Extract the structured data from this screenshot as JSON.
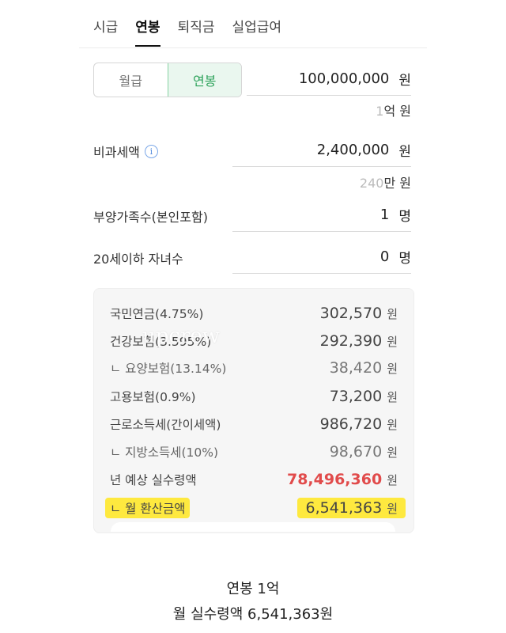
{
  "tabs": [
    {
      "label": "시급",
      "active": false
    },
    {
      "label": "연봉",
      "active": true
    },
    {
      "label": "퇴직금",
      "active": false
    },
    {
      "label": "실업급여",
      "active": false
    }
  ],
  "mode": {
    "monthly_label": "월급",
    "annual_label": "연봉",
    "selected": "연봉"
  },
  "salary": {
    "value": "100,000,000",
    "unit": "원",
    "hint_num": "1",
    "hint_text": "억 원"
  },
  "nontax": {
    "label": "비과세액",
    "info_icon": "i",
    "value": "2,400,000",
    "unit": "원",
    "hint_num": "240",
    "hint_text": "만 원"
  },
  "dependents": {
    "label": "부양가족수(본인포함)",
    "value": "1",
    "unit": "명"
  },
  "children": {
    "label": "20세이하 자녀수",
    "value": "0",
    "unit": "명"
  },
  "results": [
    {
      "label": "국민연금(4.75%)",
      "value": "302,570",
      "unit": "원",
      "sub": false
    },
    {
      "label": "건강보험(3.595%)",
      "value": "292,390",
      "unit": "원",
      "sub": false
    },
    {
      "label": "ㄴ 요양보험(13.14%)",
      "value": "38,420",
      "unit": "원",
      "sub": true
    },
    {
      "label": "고용보험(0.9%)",
      "value": "73,200",
      "unit": "원",
      "sub": false
    },
    {
      "label": "근로소득세(간이세액)",
      "value": "986,720",
      "unit": "원",
      "sub": false
    },
    {
      "label": "ㄴ 지방소득세(10%)",
      "value": "98,670",
      "unit": "원",
      "sub": true
    }
  ],
  "annual_net": {
    "label": "년 예상 실수령액",
    "value": "78,496,360",
    "unit": "원"
  },
  "monthly_net": {
    "label": "ㄴ 월 환산금액",
    "value": "6,541,363",
    "unit": "원"
  },
  "watermark": "upcrew",
  "caption": {
    "line1": "연봉 1억",
    "line2": "월 실수령액 6,541,363원"
  },
  "colors": {
    "accent_green": "#2fa35c",
    "highlight_red": "#e14b4b",
    "marker_yellow": "#ffe61e"
  }
}
